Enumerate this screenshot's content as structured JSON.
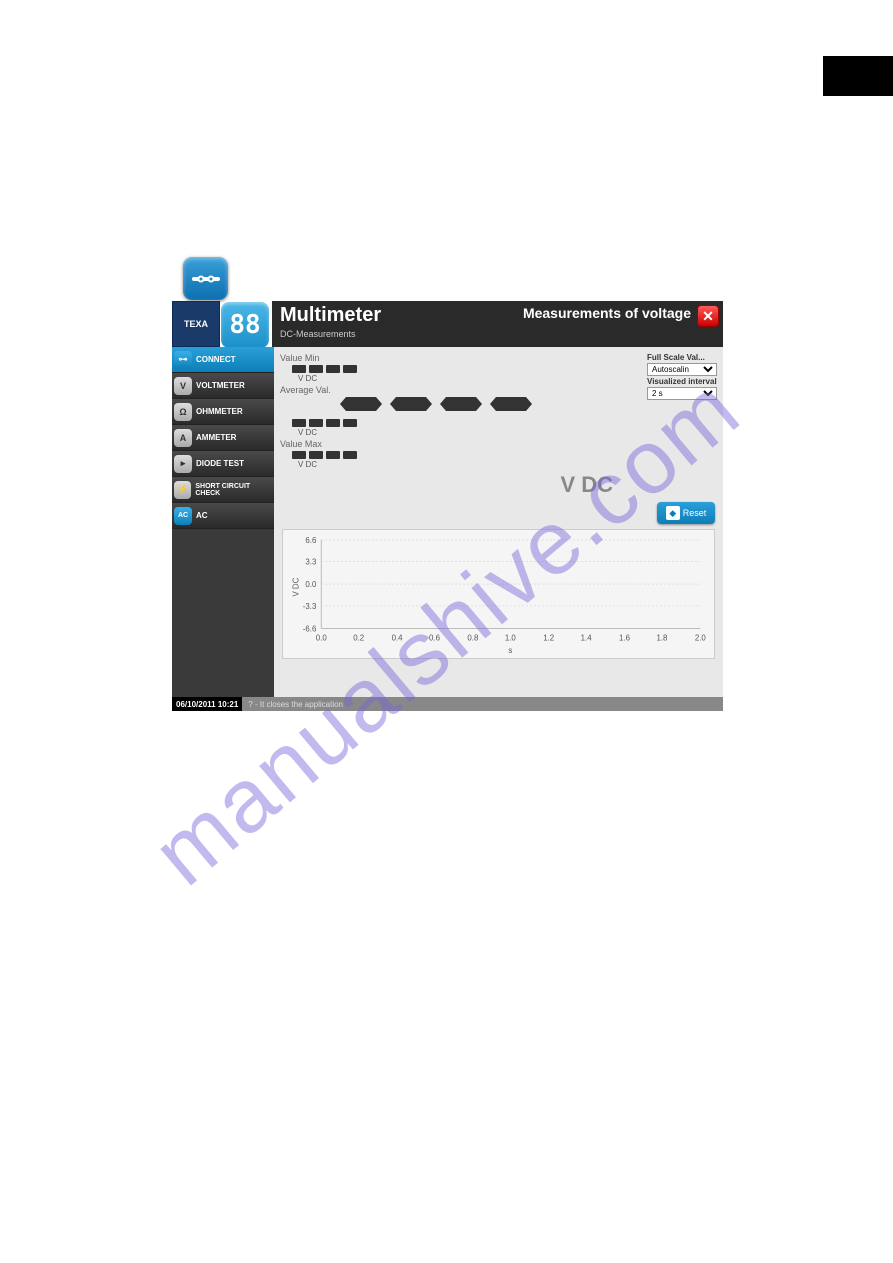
{
  "watermark": "manualshive.com",
  "app": {
    "logo1": "TEXA",
    "logo2": "88",
    "title": "Multimeter",
    "subtitle": "DC-Measurements",
    "right_title": "Measurements of voltage"
  },
  "sidebar": {
    "items": [
      {
        "label": "CONNECT",
        "active": true
      },
      {
        "label": "VOLTMETER",
        "active": false
      },
      {
        "label": "OHMMETER",
        "active": false
      },
      {
        "label": "AMMETER",
        "active": false
      },
      {
        "label": "DIODE TEST",
        "active": false
      },
      {
        "label": "SHORT CIRCUIT CHECK",
        "active": false
      },
      {
        "label": "AC",
        "active": false
      }
    ]
  },
  "readings": {
    "min_label": "Value Min",
    "avg_label": "Average Val.",
    "max_label": "Value Max",
    "unit_small": "V DC",
    "big_unit": "V DC"
  },
  "controls": {
    "fullscale_label": "Full Scale Val...",
    "fullscale_value": "Autoscalin",
    "interval_label": "Visualized interval",
    "interval_value": "2 s"
  },
  "reset_label": "Reset",
  "chart_data": {
    "type": "line",
    "title": "",
    "xlabel": "s",
    "ylabel": "V DC",
    "x_ticks": [
      "0.0",
      "0.2",
      "0.4",
      "0.6",
      "0.8",
      "1.0",
      "1.2",
      "1.4",
      "1.6",
      "1.8",
      "2.0"
    ],
    "y_ticks": [
      "-6.6",
      "-3.3",
      "0.0",
      "3.3",
      "6.6"
    ],
    "xlim": [
      0.0,
      2.0
    ],
    "ylim": [
      -6.6,
      6.6
    ],
    "values": []
  },
  "footer": {
    "timestamp": "06/10/2011 10:21",
    "hint": "? - It closes the application"
  }
}
